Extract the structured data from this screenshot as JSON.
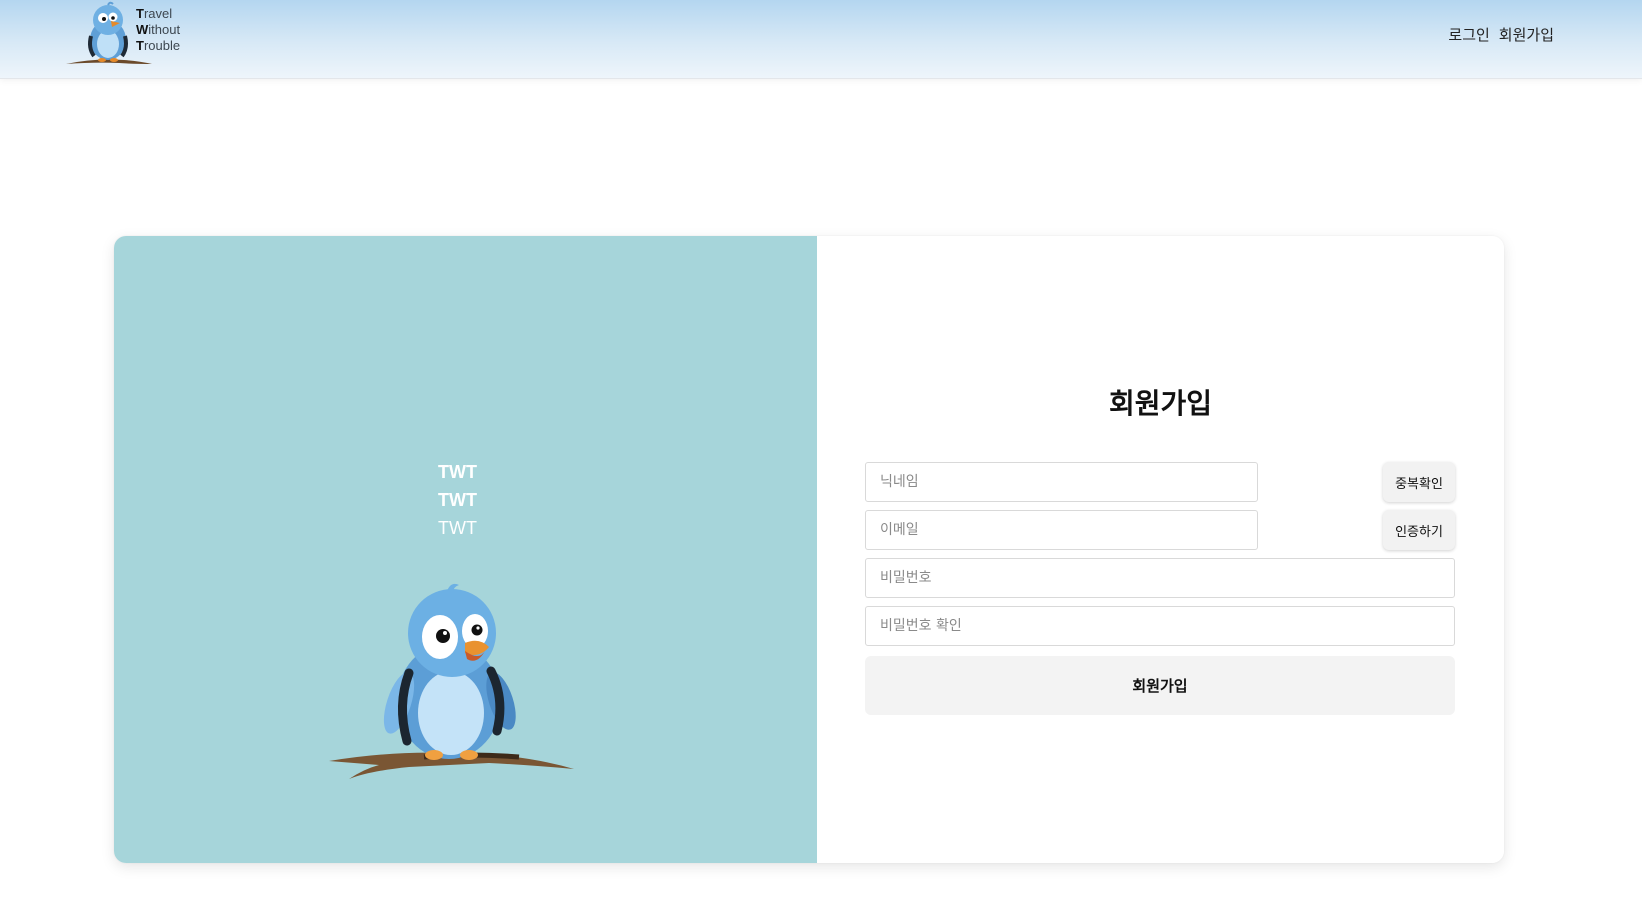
{
  "header": {
    "logo": {
      "name": "twt-bird-logo",
      "lines": [
        {
          "initial": "T",
          "rest": "ravel"
        },
        {
          "initial": "W",
          "rest": "ithout"
        },
        {
          "initial": "T",
          "rest": "rouble"
        }
      ]
    },
    "nav": {
      "login": "로그인",
      "signup": "회원가입"
    }
  },
  "left_panel": {
    "background_color": "#a6d5da",
    "lines": [
      "TWT",
      "TWT",
      "TWT"
    ],
    "illustration": "bird-mascot-on-branch"
  },
  "signup_form": {
    "title": "회원가입",
    "nickname": {
      "placeholder": "닉네임",
      "value": "",
      "check_button": "중복확인"
    },
    "email": {
      "placeholder": "이메일",
      "value": "",
      "verify_button": "인증하기"
    },
    "password": {
      "placeholder": "비밀번호",
      "value": ""
    },
    "password_confirm": {
      "placeholder": "비밀번호 확인",
      "value": ""
    },
    "submit_label": "회원가입"
  }
}
